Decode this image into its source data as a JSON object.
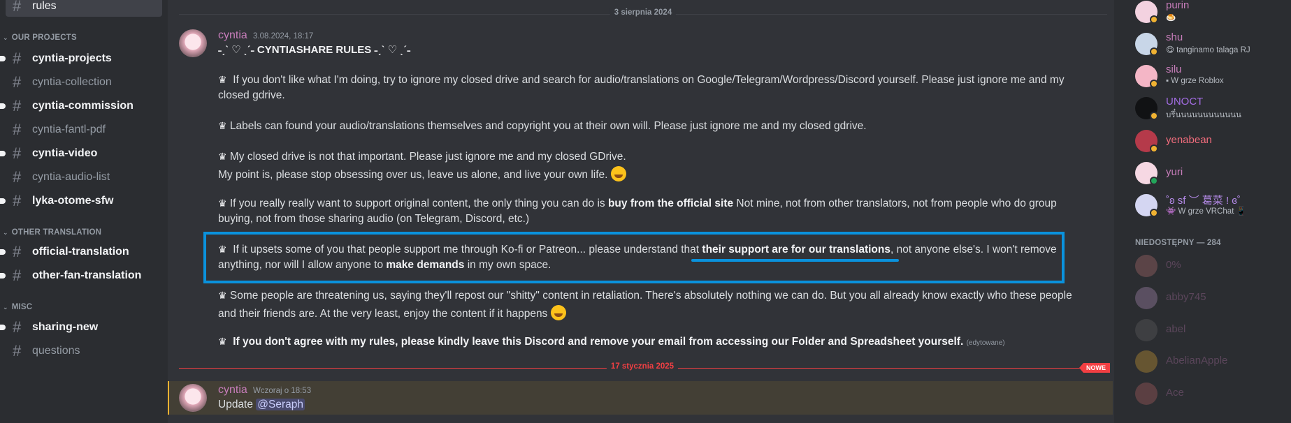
{
  "sidebar": {
    "channels": [
      {
        "name": "rules",
        "state": "selected"
      },
      {
        "name": "cyntia-projects",
        "state": "unread"
      },
      {
        "name": "cyntia-collection",
        "state": "read"
      },
      {
        "name": "cyntia-commission",
        "state": "unread"
      },
      {
        "name": "cyntia-fantl-pdf",
        "state": "read"
      },
      {
        "name": "cyntia-video",
        "state": "unread"
      },
      {
        "name": "cyntia-audio-list",
        "state": "read"
      },
      {
        "name": "lyka-otome-sfw",
        "state": "unread"
      },
      {
        "name": "official-translation",
        "state": "unread"
      },
      {
        "name": "other-fan-translation",
        "state": "unread"
      },
      {
        "name": "sharing-new",
        "state": "unread"
      },
      {
        "name": "questions",
        "state": "read"
      }
    ],
    "categories": [
      "OUR PROJECTS",
      "OTHER TRANSLATION",
      "MISC"
    ]
  },
  "messages": {
    "date_divider_1": "3 sierpnia 2024",
    "msg1": {
      "author": "cyntia",
      "timestamp": "3.08.2024, 18:17",
      "title": "˗ˏˋ ♡ ˎˊ˗ CYNTIASHARE RULES ˗ˏˋ ♡ ˎˊ˗",
      "p1a": "If you don't like what I'm doing, try to ignore my closed drive and search for audio/translations on Google/Telegram/Wordpress/Discord yourself. Please just ignore me and my",
      "p1b": "closed gdrive.",
      "p2": "Labels can found your audio/translations themselves and copyright you at their own will. Please just ignore me and my closed gdrive.",
      "p3a": "My closed drive is not that important. Please just ignore me and my closed GDrive.",
      "p3b": "My point is, please stop obsessing over us, leave us alone, and live your own life.",
      "p4a_pre": "If you really really want to support original content, the only thing you can do is ",
      "p4a_bold": "buy from the official site",
      "p4a_post": " Not mine, not from other translators, not from people who do group",
      "p4b": "buying, not from those sharing audio (on Telegram, Discord, etc.)",
      "p5a_pre": "If it upsets some of you that people support me through Ko-fi or Patreon... please understand that ",
      "p5a_bold": "their support are for our translations",
      "p5a_post": ", not anyone else's. I won't remove",
      "p5b_pre": "anything, nor will I allow anyone to ",
      "p5b_bold": "make demands",
      "p5b_post": " in my own space.",
      "p6a": "Some people are threatening us, saying they'll repost our \"shitty\" content in retaliation. There's absolutely nothing we can do. But you all already know exactly who these people",
      "p6b": "and their friends are. At the very least, enjoy the content if it happens",
      "p7": "If you don't agree with my rules, please kindly leave this Discord and remove your email from accessing our Folder and Spreadsheet yourself.",
      "edited": "(edytowane)",
      "crown": "♛"
    },
    "date_divider_2": "17 stycznia 2025",
    "new_badge": "NOWE",
    "msg2": {
      "author": "cyntia",
      "timestamp": "Wczoraj o 18:53",
      "text": "Update ",
      "mention": "@Seraph"
    }
  },
  "members": {
    "online": [
      {
        "name": "purin",
        "activity": "🍮",
        "color": "#c77dba",
        "avatar": "#f3d2e0",
        "status": "#f0b232"
      },
      {
        "name": "shu",
        "activity": "😋 tanginamo talaga RJ",
        "color": "#c77dba",
        "avatar": "#c8d6e8",
        "status": "#f0b232"
      },
      {
        "name": "silu",
        "activity": "▪ W grze Roblox",
        "color": "#c77dba",
        "avatar": "#f4b6c6",
        "status": "#f0b232"
      },
      {
        "name": "UNOCT",
        "activity": "บรึ๋นนนนนนนนนนนน",
        "color": "#a56ee6",
        "avatar": "#111214",
        "status": "#f0b232"
      },
      {
        "name": "yenabean",
        "activity": "",
        "color": "#f26d7d",
        "avatar": "#b53a4a",
        "status": "#f0b232"
      },
      {
        "name": "yuri",
        "activity": "",
        "color": "#c77dba",
        "avatar": "#f6d8e3",
        "status": "#23a55a"
      },
      {
        "name": "˚ʚ sf ︶ 葛菜 ! ɞ˚",
        "activity": "👾 W grze VRChat 📱",
        "color": "#b48ae8",
        "avatar": "#d4d6f2",
        "status": "#f0b232"
      }
    ],
    "offline_header": "NIEDOSTĘPNY — 284",
    "offline": [
      {
        "name": "0%",
        "avatar": "#c97a7a"
      },
      {
        "name": "abby745",
        "avatar": "#c7a0d0"
      },
      {
        "name": "abel",
        "avatar": "#6a6a6a"
      },
      {
        "name": "AbelianApple",
        "avatar": "#f0b232"
      },
      {
        "name": "Ace",
        "avatar": "#c96a6a"
      }
    ]
  }
}
